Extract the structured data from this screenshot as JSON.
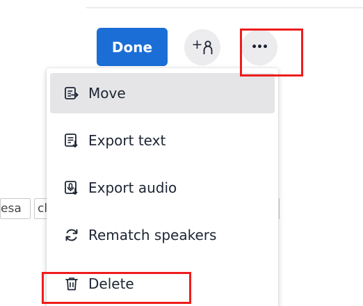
{
  "toolbar": {
    "done_label": "Done",
    "add_speaker_glyph": "+",
    "more_glyph": "•••",
    "accent_color": "#1b6ed6"
  },
  "background_chips": [
    "esa",
    "cl"
  ],
  "menu": {
    "items": [
      {
        "label": "Move",
        "icon": "move-icon"
      },
      {
        "label": "Export text",
        "icon": "export-text-icon"
      },
      {
        "label": "Export audio",
        "icon": "export-audio-icon"
      },
      {
        "label": "Rematch speakers",
        "icon": "rematch-icon"
      },
      {
        "label": "Delete",
        "icon": "trash-icon"
      }
    ]
  },
  "annotation_color": "#ee1c1c"
}
